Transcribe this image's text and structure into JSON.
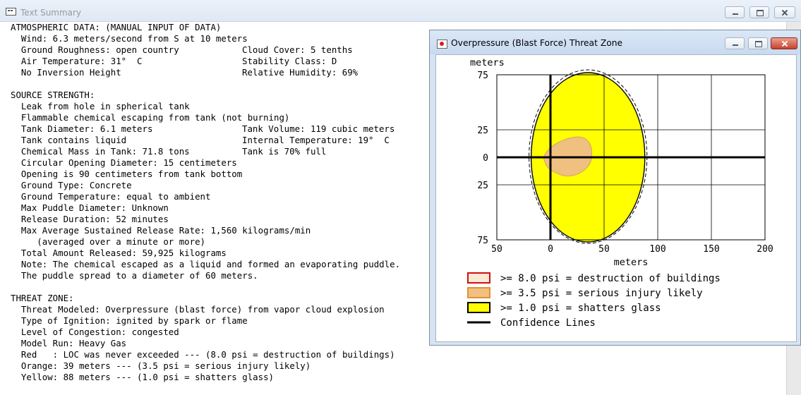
{
  "text_summary": {
    "title": "Text Summary",
    "lines": [
      [
        "ATMOSPHERIC DATA: (MANUAL INPUT OF DATA)",
        ""
      ],
      [
        "  Wind: 6.3 meters/second from S at 10 meters",
        ""
      ],
      [
        "  Ground Roughness: open country",
        "Cloud Cover: 5 tenths"
      ],
      [
        "  Air Temperature: 31°  C",
        "Stability Class: D"
      ],
      [
        "  No Inversion Height",
        "Relative Humidity: 69%"
      ],
      [
        "",
        ""
      ],
      [
        "SOURCE STRENGTH:",
        ""
      ],
      [
        "  Leak from hole in spherical tank",
        ""
      ],
      [
        "  Flammable chemical escaping from tank (not burning)",
        ""
      ],
      [
        "  Tank Diameter: 6.1 meters",
        "Tank Volume: 119 cubic meters"
      ],
      [
        "  Tank contains liquid",
        "Internal Temperature: 19°  C"
      ],
      [
        "  Chemical Mass in Tank: 71.8 tons",
        "Tank is 70% full"
      ],
      [
        "  Circular Opening Diameter: 15 centimeters",
        ""
      ],
      [
        "  Opening is 90 centimeters from tank bottom",
        ""
      ],
      [
        "  Ground Type: Concrete",
        ""
      ],
      [
        "  Ground Temperature: equal to ambient",
        ""
      ],
      [
        "  Max Puddle Diameter: Unknown",
        ""
      ],
      [
        "  Release Duration: 52 minutes",
        ""
      ],
      [
        "  Max Average Sustained Release Rate: 1,560 kilograms/min",
        ""
      ],
      [
        "     (averaged over a minute or more)",
        ""
      ],
      [
        "  Total Amount Released: 59,925 kilograms",
        ""
      ],
      [
        "  Note: The chemical escaped as a liquid and formed an evaporating puddle.",
        ""
      ],
      [
        "  The puddle spread to a diameter of 60 meters.",
        ""
      ],
      [
        "",
        ""
      ],
      [
        "THREAT ZONE:",
        ""
      ],
      [
        "  Threat Modeled: Overpressure (blast force) from vapor cloud explosion",
        ""
      ],
      [
        "  Type of Ignition: ignited by spark or flame",
        ""
      ],
      [
        "  Level of Congestion: congested",
        ""
      ],
      [
        "  Model Run: Heavy Gas",
        ""
      ],
      [
        "  Red   : LOC was never exceeded --- (8.0 psi = destruction of buildings)",
        ""
      ],
      [
        "  Orange: 39 meters --- (3.5 psi = serious injury likely)",
        ""
      ],
      [
        "  Yellow: 88 meters --- (1.0 psi = shatters glass)",
        ""
      ]
    ]
  },
  "threat_zone_window": {
    "title": "Overpressure (Blast Force) Threat Zone",
    "plot": {
      "y_axis_title": "meters",
      "x_axis_title": "meters",
      "x_ticks": [
        "50",
        "0",
        "50",
        "100",
        "150",
        "200"
      ],
      "x_tick_values": [
        -50,
        0,
        50,
        100,
        150,
        200
      ],
      "y_ticks": [
        "75",
        "25",
        "0",
        "25",
        "75"
      ],
      "y_tick_values": [
        75,
        25,
        0,
        -25,
        -75
      ],
      "x_range": [
        -50,
        200
      ],
      "y_range": [
        -75,
        75
      ],
      "grid": true
    },
    "zones": {
      "yellow_reach_m": 88,
      "orange_reach_m": 39,
      "colors": {
        "yellow": "#ffff00",
        "orange": "#f0c080",
        "red": "#d01010",
        "confidence": "#000000"
      }
    },
    "legend": [
      {
        "label": ">= 8.0 psi = destruction of buildings",
        "swatch": "red"
      },
      {
        "label": ">= 3.5 psi = serious injury likely",
        "swatch": "orange"
      },
      {
        "label": ">= 1.0 psi = shatters glass",
        "swatch": "yellow"
      },
      {
        "label": "Confidence Lines",
        "swatch": "line"
      }
    ]
  }
}
